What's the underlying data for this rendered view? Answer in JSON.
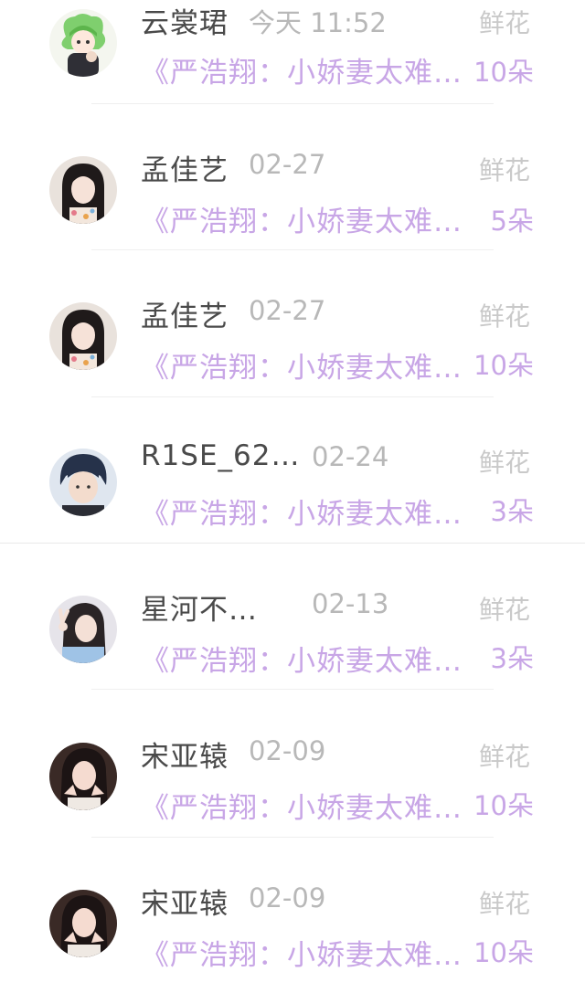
{
  "records": [
    {
      "name": "云裳珺",
      "date": "今天 11:52",
      "gift_type": "鲜花",
      "book": "《严浩翔：小娇妻太难…",
      "count": "10朵",
      "avatar_icon": "avatar-anime-green"
    },
    {
      "name": "孟佳艺",
      "date": "02-27",
      "gift_type": "鲜花",
      "book": "《严浩翔：小娇妻太难…",
      "count": "5朵",
      "avatar_icon": "avatar-girl-floral"
    },
    {
      "name": "孟佳艺",
      "date": "02-27",
      "gift_type": "鲜花",
      "book": "《严浩翔：小娇妻太难…",
      "count": "10朵",
      "avatar_icon": "avatar-girl-floral"
    },
    {
      "name": "R1SE_62…",
      "date": "02-24",
      "gift_type": "鲜花",
      "book": "《严浩翔：小娇妻太难…",
      "count": "3朵",
      "avatar_icon": "avatar-boy"
    },
    {
      "name": "星河不…",
      "date": "02-13",
      "gift_type": "鲜花",
      "book": "《严浩翔：小娇妻太难…",
      "count": "3朵",
      "avatar_icon": "avatar-girl-peace"
    },
    {
      "name": "宋亚辕",
      "date": "02-09",
      "gift_type": "鲜花",
      "book": "《严浩翔：小娇妻太难…",
      "count": "10朵",
      "avatar_icon": "avatar-girl-hands"
    },
    {
      "name": "宋亚辕",
      "date": "02-09",
      "gift_type": "鲜花",
      "book": "《严浩翔：小娇妻太难…",
      "count": "10朵",
      "avatar_icon": "avatar-girl-hands"
    }
  ],
  "colors": {
    "name": "#4a4a4a",
    "date": "#b8b8b8",
    "gift_type": "#c9c9c9",
    "accent_purple": "#c8a6e6"
  }
}
